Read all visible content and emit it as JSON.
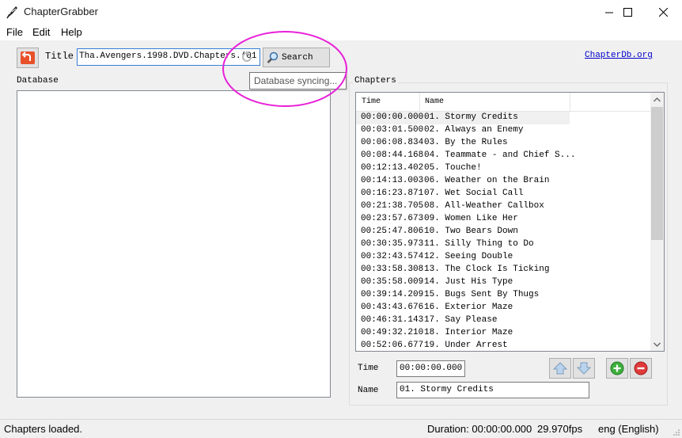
{
  "window": {
    "title": "ChapterGrabber",
    "icon": "feather-quill-icon"
  },
  "menu": [
    "File",
    "Edit",
    "Help"
  ],
  "toolbar": {
    "title_label": "Title",
    "title_value": "Tha.Avengers.1998.DVD.Chapters.(01",
    "search_label": "Search",
    "link_label": "ChapterDb.org"
  },
  "tooltip": "Database syncing...",
  "groups": {
    "database": "Database",
    "chapters": "Chapters"
  },
  "chapters_table": {
    "columns": [
      "Time",
      "Name"
    ],
    "rows": [
      {
        "time": "00:00:00.000",
        "name": "01. Stormy Credits"
      },
      {
        "time": "00:03:01.500",
        "name": "02. Always an Enemy"
      },
      {
        "time": "00:06:08.834",
        "name": "03. By the Rules"
      },
      {
        "time": "00:08:44.168",
        "name": "04. Teammate - and Chief S..."
      },
      {
        "time": "00:12:13.402",
        "name": "05. Touche!"
      },
      {
        "time": "00:14:13.003",
        "name": "06. Weather on the Brain"
      },
      {
        "time": "00:16:23.871",
        "name": "07. Wet Social Call"
      },
      {
        "time": "00:21:38.705",
        "name": "08. All-Weather Callbox"
      },
      {
        "time": "00:23:57.673",
        "name": "09. Women Like Her"
      },
      {
        "time": "00:25:47.806",
        "name": "10. Two Bears Down"
      },
      {
        "time": "00:30:35.973",
        "name": "11. Silly Thing to Do"
      },
      {
        "time": "00:32:43.574",
        "name": "12. Seeing Double"
      },
      {
        "time": "00:33:58.308",
        "name": "13. The Clock Is Ticking"
      },
      {
        "time": "00:35:58.009",
        "name": "14. Just His Type"
      },
      {
        "time": "00:39:14.209",
        "name": "15. Bugs Sent By Thugs"
      },
      {
        "time": "00:43:43.676",
        "name": "16. Exterior Maze"
      },
      {
        "time": "00:46:31.143",
        "name": "17. Say Please"
      },
      {
        "time": "00:49:32.210",
        "name": "18. Interior Maze"
      },
      {
        "time": "00:52:06.677",
        "name": "19. Under Arrest"
      }
    ],
    "selected_index": 0
  },
  "editor": {
    "time_label": "Time",
    "time_value": "00:00:00.000",
    "name_label": "Name",
    "name_value": "01. Stormy Credits"
  },
  "status": {
    "message": "Chapters loaded.",
    "duration": "Duration: 00:00:00.000",
    "fps": "29.970fps",
    "language": "eng (English)"
  },
  "colors": {
    "highlight_annotation": "#e820d8",
    "link": "#0000cc",
    "add": "#2e9e2e",
    "remove": "#d62b2b"
  }
}
